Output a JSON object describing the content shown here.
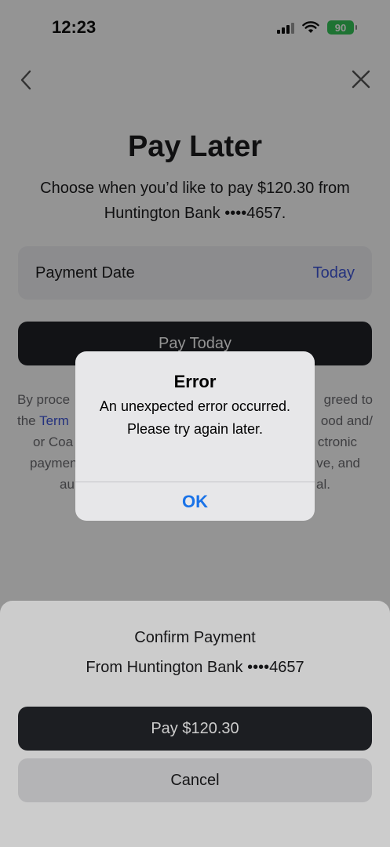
{
  "status_bar": {
    "time": "12:23",
    "battery": "90",
    "icons": [
      "signal-icon",
      "wifi-icon",
      "battery-icon"
    ]
  },
  "nav": {
    "back_icon": "chevron-left-icon",
    "close_icon": "close-icon"
  },
  "page": {
    "title": "Pay Later",
    "subtitle": "Choose when you’d like to pay $120.30 from Huntington Bank ••••4657.",
    "payment_date_label": "Payment Date",
    "payment_date_value": "Today",
    "pay_today_label": "Pay Today",
    "terms_visible_fragments": [
      "By proce",
      "greed to",
      "the ",
      "Term",
      "ood and/",
      "or Coa",
      "ctronic",
      "paymen",
      "ve, and",
      "au",
      "al."
    ]
  },
  "sheet": {
    "title": "Confirm Payment",
    "subtitle": "From Huntington Bank ••••4657",
    "pay_label": "Pay $120.30",
    "cancel_label": "Cancel"
  },
  "alert": {
    "title": "Error",
    "message": "An unexpected error occurred. Please try again later.",
    "ok_label": "OK"
  },
  "colors": {
    "accent": "#3f56d9",
    "ios_blue": "#1a73e8",
    "dark_button": "#1f2126",
    "battery_green": "#34c759"
  }
}
